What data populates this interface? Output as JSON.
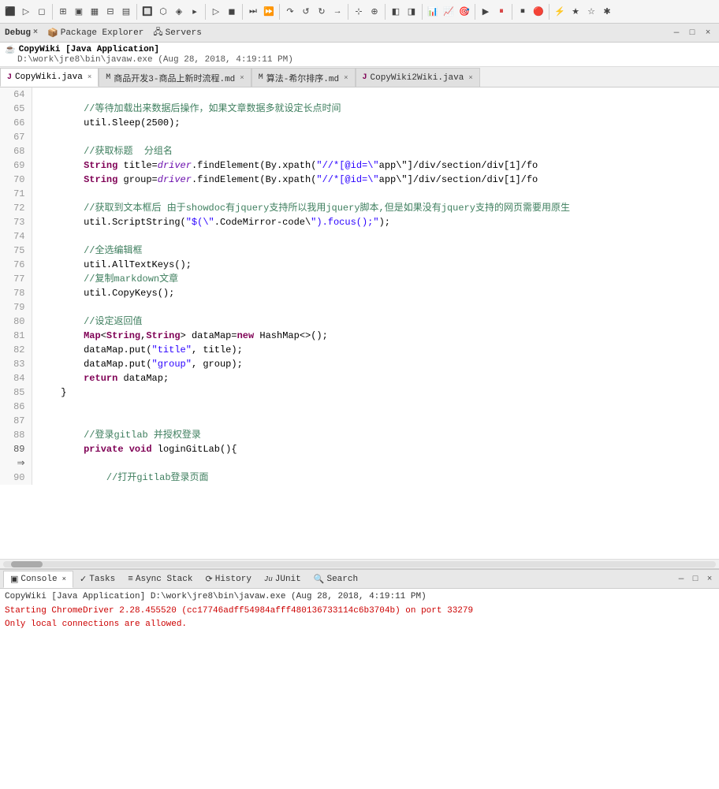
{
  "toolbar": {
    "icons": [
      "⬛",
      "▷",
      "◻",
      "⚙",
      "📄",
      "📋",
      "🔍",
      "⬜",
      "◼",
      "▣",
      "⊞",
      "⊟",
      "▦",
      "🔲",
      "⬡",
      "▶",
      "⏸",
      "⏹",
      "🔴",
      "⚡",
      "📊",
      "📈",
      "🎯",
      "⊕",
      "⊗",
      "◈",
      "▸",
      "⏭",
      "⏩",
      "→",
      "⇒",
      "↷",
      "↺",
      "↻",
      "⊹",
      "⊕",
      "⊞",
      "◧",
      "◨",
      "◩",
      "◪",
      "▨",
      "▷",
      "▸",
      "►",
      "■",
      "▪",
      "▫",
      "●",
      "○",
      "◉",
      "▲",
      "△",
      "▼",
      "▽",
      "◆",
      "◇",
      "★",
      "☆",
      "✱",
      "✦",
      "❖",
      "⚑",
      "⚐",
      "⚔",
      "⚙"
    ]
  },
  "perspective": {
    "debug_label": "Debug",
    "debug_close": "×",
    "package_explorer_label": "Package Explorer",
    "servers_label": "Servers"
  },
  "app": {
    "title": "CopyWiki [Java Application]",
    "subtitle": "D:\\work\\jre8\\bin\\javaw.exe (Aug 28, 2018, 4:19:11 PM)"
  },
  "tabs": [
    {
      "label": "CopyWiki.java",
      "active": true,
      "icon": "J",
      "closeable": true
    },
    {
      "label": "商品开发3-商品上新时流程.md",
      "active": false,
      "icon": "M",
      "closeable": true
    },
    {
      "label": "算法-希尔排序.md",
      "active": false,
      "icon": "M",
      "closeable": true
    },
    {
      "label": "CopyWiki2Wiki.java",
      "active": false,
      "icon": "J",
      "closeable": true
    }
  ],
  "code": {
    "lines": [
      {
        "num": "64",
        "content": "",
        "arrow": false
      },
      {
        "num": "65",
        "content": "        //等待加载出来数据后操作，如果文章数据多就设定长点时间",
        "comment": true
      },
      {
        "num": "66",
        "content": "        util.Sleep(2500);",
        "comment": false
      },
      {
        "num": "67",
        "content": "",
        "comment": false
      },
      {
        "num": "68",
        "content": "        //获取标题  分组名",
        "comment": true
      },
      {
        "num": "69",
        "content": "        String title=driver.findElement(By.xpath(\"//*[@id=\\\"app\\\"]/div/section/div[1]/fo",
        "comment": false
      },
      {
        "num": "70",
        "content": "        String group=driver.findElement(By.xpath(\"//*[@id=\\\"app\\\"]/div/section/div[1]/fo",
        "comment": false
      },
      {
        "num": "71",
        "content": "",
        "comment": false
      },
      {
        "num": "72",
        "content": "        //获取到文本框后 由于showdoc有jquery支持所以我用jquery脚本,但是如果没有jquery支持的网页需要用原生",
        "comment": true
      },
      {
        "num": "73",
        "content": "        util.ScriptString(\"$(\\\".CodeMirror-code\\\").focus();\");",
        "comment": false
      },
      {
        "num": "74",
        "content": "",
        "comment": false
      },
      {
        "num": "75",
        "content": "        //全选编辑框",
        "comment": true
      },
      {
        "num": "76",
        "content": "        util.AllTextKeys();",
        "comment": false
      },
      {
        "num": "77",
        "content": "        //复制markdown文章",
        "comment": true
      },
      {
        "num": "78",
        "content": "        util.CopyKeys();",
        "comment": false
      },
      {
        "num": "79",
        "content": "",
        "comment": false
      },
      {
        "num": "80",
        "content": "        //设定返回值",
        "comment": true
      },
      {
        "num": "81",
        "content": "        Map<String,String> dataMap=new HashMap<>();",
        "comment": false
      },
      {
        "num": "82",
        "content": "        dataMap.put(\"title\", title);",
        "comment": false
      },
      {
        "num": "83",
        "content": "        dataMap.put(\"group\", group);",
        "comment": false
      },
      {
        "num": "84",
        "content": "        return dataMap;",
        "comment": false
      },
      {
        "num": "85",
        "content": "    }",
        "comment": false
      },
      {
        "num": "86",
        "content": "",
        "comment": false
      },
      {
        "num": "87",
        "content": "",
        "comment": false
      },
      {
        "num": "88",
        "content": "        //登录gitlab 并授权登录",
        "comment": true
      },
      {
        "num": "89",
        "content": "        private void loginGitLab(){",
        "comment": false,
        "arrow": true
      },
      {
        "num": "90",
        "content": "            //打开gitlab登录页面",
        "comment": true
      }
    ]
  },
  "bottom_panel": {
    "tabs": [
      {
        "label": "Console",
        "active": true,
        "icon": "▣"
      },
      {
        "label": "Tasks",
        "active": false,
        "icon": "✓"
      },
      {
        "label": "Async Stack",
        "active": false,
        "icon": "≡"
      },
      {
        "label": "History",
        "active": false,
        "icon": "⟳"
      },
      {
        "label": "JUnit",
        "active": false,
        "icon": "Ju"
      },
      {
        "label": "Search",
        "active": false,
        "icon": "🔍"
      }
    ],
    "console_header": "CopyWiki [Java Application] D:\\work\\jre8\\bin\\javaw.exe (Aug 28, 2018, 4:19:11 PM)",
    "console_lines": [
      "Starting ChromeDriver 2.28.455520 (cc17746adff54984afff480136733114c6b3704b) on port 33279",
      "Only local connections are allowed."
    ]
  }
}
